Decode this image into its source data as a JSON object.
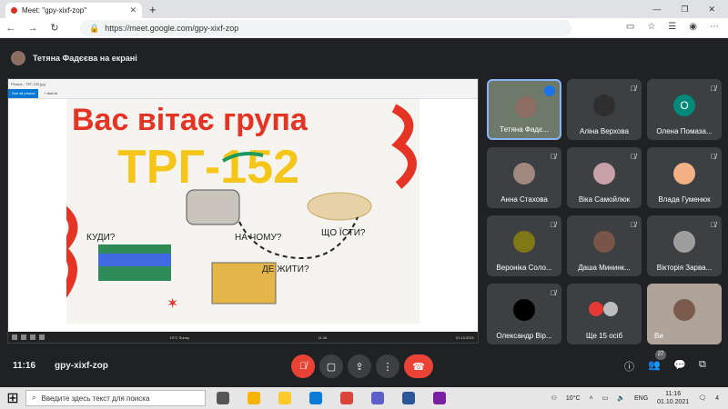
{
  "browser": {
    "tab_title": "Meet: \"gpy-xixf-zop\"",
    "url": "https://meet.google.com/gpy-xixf-zop"
  },
  "presenter": {
    "label": "Тетяна Фадєєва на екрані"
  },
  "photos_app": {
    "title": "Photos - ТРГ-152.jpg",
    "see_all": "See all photos",
    "add_to": "+ Add to",
    "clock_time": "11:16",
    "clock_date": "01.10.2021",
    "weather": "10°C Sunny"
  },
  "poster": {
    "line1": "Вас вітає група",
    "line2": "ТРГ-152",
    "word_kudy": "КУДИ?",
    "word_na_chomu": "НА ЧОМУ?",
    "word_shcho_isty": "ЩО ЇСТИ?",
    "word_de_zhyty": "ДЕ ЖИТИ?"
  },
  "participants": [
    {
      "name": "Тетяна Фадє...",
      "speaking": true
    },
    {
      "name": "Аліна Верхова"
    },
    {
      "name": "Олена Помаза...",
      "initial": "О"
    },
    {
      "name": "Анна Стахова"
    },
    {
      "name": "Віка Самойлюк"
    },
    {
      "name": "Влада Гуменюк"
    },
    {
      "name": "Вероніка Соло..."
    },
    {
      "name": "Даша Мининк..."
    },
    {
      "name": "Вікторія Зарва..."
    },
    {
      "name": "Олександр Вір..."
    },
    {
      "name": "Ще 15 осіб"
    },
    {
      "name": "Ви"
    }
  ],
  "meeting_bar": {
    "time": "11:16",
    "code": "gpy-xixf-zop",
    "people_count": "27"
  },
  "taskbar": {
    "search_placeholder": "Введите здесь текст для поиска",
    "weather": "10°C",
    "lang": "ENG",
    "time": "11:16",
    "date": "01.10.2021",
    "notif_count": "4"
  },
  "colors": {
    "meet_bg": "#202124",
    "tile_bg": "#3c4043",
    "red": "#ea4335",
    "poster_red": "#e53324",
    "poster_yellow": "#f5c518",
    "poster_blue": "#1f5fb8"
  }
}
